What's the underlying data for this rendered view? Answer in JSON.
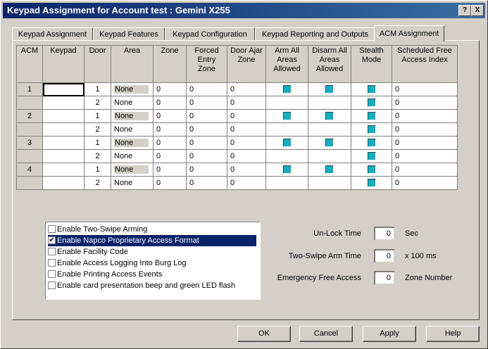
{
  "window": {
    "title": "Keypad Assignment for Account test : Gemini X255",
    "help_label": "?",
    "close_label": "X"
  },
  "tabs": [
    "Keypad Assignment",
    "Keypad Features",
    "Keypad Configuration",
    "Keypad Reporting and Outputs",
    "ACM Assignment"
  ],
  "active_tab": "ACM Assignment",
  "grid": {
    "columns": [
      "ACM",
      "Keypad",
      "Door",
      "Area",
      "Zone",
      "Forced Entry Zone",
      "Door Ajar Zone",
      "Arm All Areas Allowed",
      "Disarm All Areas Allowed",
      "Stealth Mode",
      "Scheduled Free Access Index"
    ],
    "rows": [
      {
        "acm": "1",
        "keypad": "",
        "door": "1",
        "area": "None",
        "zone": "0",
        "forced": "0",
        "ajar": "0",
        "arm_all": true,
        "disarm_all": true,
        "stealth": true,
        "index": "0"
      },
      {
        "acm": "",
        "keypad": "",
        "door": "2",
        "area": "None",
        "zone": "0",
        "forced": "0",
        "ajar": "0",
        "arm_all": false,
        "disarm_all": false,
        "stealth": true,
        "index": "0"
      },
      {
        "acm": "2",
        "keypad": "",
        "door": "1",
        "area": "None",
        "zone": "0",
        "forced": "0",
        "ajar": "0",
        "arm_all": true,
        "disarm_all": true,
        "stealth": true,
        "index": "0"
      },
      {
        "acm": "",
        "keypad": "",
        "door": "2",
        "area": "None",
        "zone": "0",
        "forced": "0",
        "ajar": "0",
        "arm_all": false,
        "disarm_all": false,
        "stealth": true,
        "index": "0"
      },
      {
        "acm": "3",
        "keypad": "",
        "door": "1",
        "area": "None",
        "zone": "0",
        "forced": "0",
        "ajar": "0",
        "arm_all": true,
        "disarm_all": true,
        "stealth": true,
        "index": "0"
      },
      {
        "acm": "",
        "keypad": "",
        "door": "2",
        "area": "None",
        "zone": "0",
        "forced": "0",
        "ajar": "0",
        "arm_all": false,
        "disarm_all": false,
        "stealth": true,
        "index": "0"
      },
      {
        "acm": "4",
        "keypad": "",
        "door": "1",
        "area": "None",
        "zone": "0",
        "forced": "0",
        "ajar": "0",
        "arm_all": true,
        "disarm_all": true,
        "stealth": true,
        "index": "0"
      },
      {
        "acm": "",
        "keypad": "",
        "door": "2",
        "area": "None",
        "zone": "0",
        "forced": "0",
        "ajar": "0",
        "arm_all": false,
        "disarm_all": false,
        "stealth": true,
        "index": "0"
      }
    ]
  },
  "options": [
    {
      "label": "Enable Two-Swipe Arming",
      "checked": false,
      "selected": false
    },
    {
      "label": "Enable Napco Proprietary Access Format",
      "checked": true,
      "selected": true
    },
    {
      "label": "Enable Facility Code",
      "checked": false,
      "selected": false
    },
    {
      "label": "Enable Access Logging Into Burg Log",
      "checked": false,
      "selected": false
    },
    {
      "label": "Enable Printing Access Events",
      "checked": false,
      "selected": false
    },
    {
      "label": "Enable card presentation beep and green LED flash",
      "checked": false,
      "selected": false
    }
  ],
  "fields": {
    "unlock": {
      "label": "Un-Lock Time",
      "value": "0",
      "unit": "Sec"
    },
    "two_swipe": {
      "label": "Two-Swipe Arm Time",
      "value": "0",
      "unit": "x 100 ms"
    },
    "emergency": {
      "label": "Emergency Free Access",
      "value": "0",
      "unit": "Zone Number"
    }
  },
  "buttons": {
    "ok": "OK",
    "cancel": "Cancel",
    "apply": "Apply",
    "help": "Help"
  },
  "colors": {
    "title_start": "#0a246a",
    "title_end": "#3a6ea5",
    "checkbox_fill": "#0ab2c4"
  }
}
